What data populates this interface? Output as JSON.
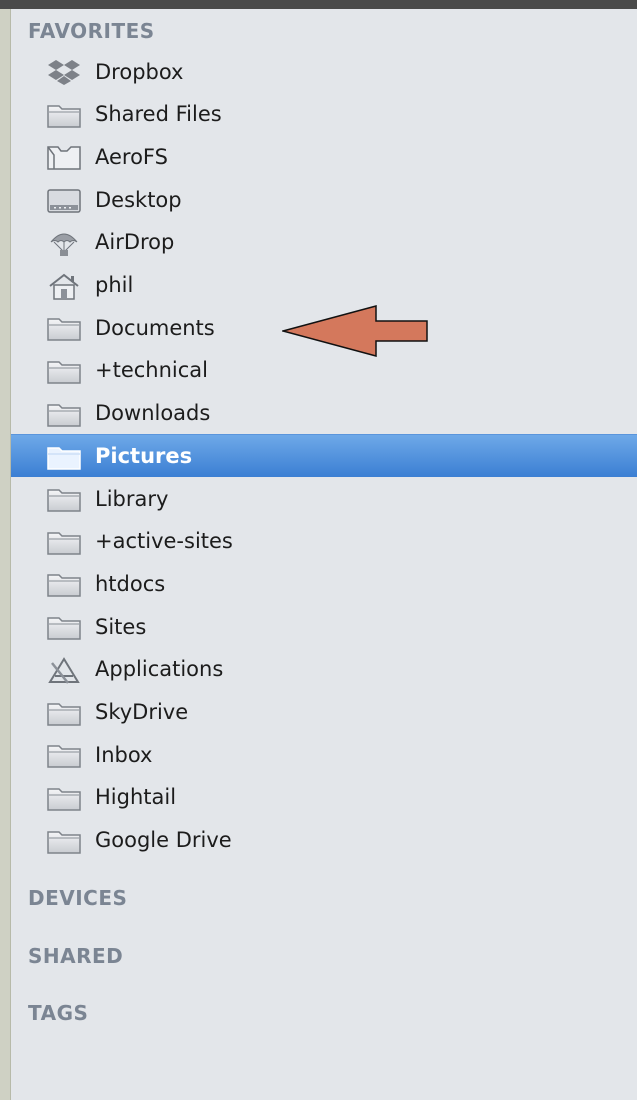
{
  "sidebar": {
    "favorites_header": "FAVORITES",
    "devices_header": "DEVICES",
    "shared_header": "SHARED",
    "tags_header": "TAGS",
    "items": [
      {
        "label": "Dropbox",
        "icon": "dropbox-icon"
      },
      {
        "label": "Shared Files",
        "icon": "folder-icon"
      },
      {
        "label": "AeroFS",
        "icon": "aerofs-folder-icon"
      },
      {
        "label": "Desktop",
        "icon": "desktop-icon"
      },
      {
        "label": "AirDrop",
        "icon": "airdrop-icon"
      },
      {
        "label": "phil",
        "icon": "home-icon"
      },
      {
        "label": "Documents",
        "icon": "folder-icon"
      },
      {
        "label": "+technical",
        "icon": "folder-icon"
      },
      {
        "label": "Downloads",
        "icon": "folder-icon"
      },
      {
        "label": "Pictures",
        "icon": "folder-icon",
        "selected": true
      },
      {
        "label": "Library",
        "icon": "folder-icon"
      },
      {
        "label": "+active-sites",
        "icon": "folder-icon"
      },
      {
        "label": "htdocs",
        "icon": "folder-icon"
      },
      {
        "label": "Sites",
        "icon": "folder-icon"
      },
      {
        "label": "Applications",
        "icon": "applications-icon"
      },
      {
        "label": "SkyDrive",
        "icon": "folder-icon"
      },
      {
        "label": "Inbox",
        "icon": "folder-icon"
      },
      {
        "label": "Hightail",
        "icon": "folder-icon"
      },
      {
        "label": "Google Drive",
        "icon": "folder-icon"
      }
    ]
  },
  "annotation": {
    "arrow_color": "#d4785c",
    "arrow_target": "Documents"
  },
  "colors": {
    "sidebar_bg": "#e3e6ea",
    "selection": "#4a8ad9",
    "header_text": "#7b8593"
  }
}
